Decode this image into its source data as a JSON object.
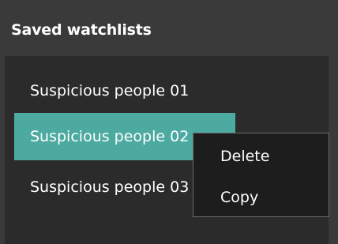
{
  "panel": {
    "title": "Saved watchlists"
  },
  "watchlists": [
    {
      "label": "Suspicious people 01",
      "selected": false
    },
    {
      "label": "Suspicious people 02",
      "selected": true
    },
    {
      "label": "Suspicious people 03",
      "selected": false
    }
  ],
  "context_menu": {
    "items": [
      {
        "label": "Delete"
      },
      {
        "label": "Copy"
      }
    ]
  },
  "colors": {
    "background": "#3a3a3a",
    "list_background": "#2b2b2b",
    "selection": "#4caaa0",
    "menu_background": "#1d1d1d",
    "menu_border": "#6a6a6a",
    "text": "#ffffff"
  }
}
